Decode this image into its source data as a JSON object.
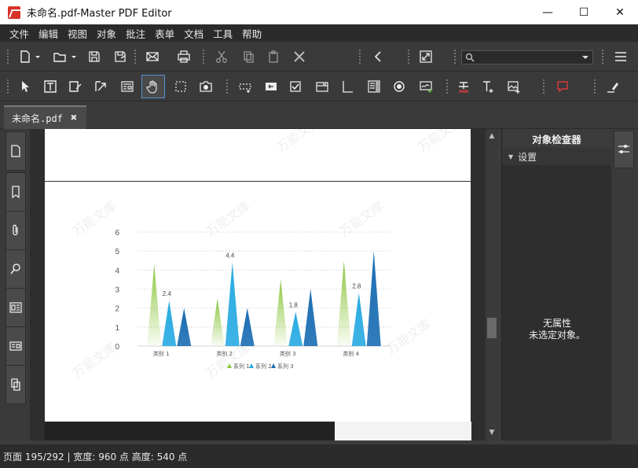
{
  "window": {
    "title": "未命名.pdf-Master PDF Editor",
    "minimize": "—",
    "maximize": "☐",
    "close": "✕"
  },
  "menu": [
    "文件",
    "编辑",
    "视图",
    "对象",
    "批注",
    "表单",
    "文档",
    "工具",
    "帮助"
  ],
  "tab": {
    "label": "未命名.pdf",
    "close": "✖"
  },
  "inspector": {
    "title": "对象检查器",
    "section": "设置",
    "empty_line1": "无属性",
    "empty_line2": "未选定对象。"
  },
  "status": "页面 195/292 | 宽度: 960 点 高度: 540 点",
  "colors": {
    "accent": "#5a8fd0",
    "series1": "#8dc63f",
    "series2": "#29abe2",
    "series3": "#1b6eb3"
  },
  "chart_data": {
    "type": "bar",
    "categories": [
      "类别 1",
      "类别 2",
      "类别 3",
      "类别 4"
    ],
    "series": [
      {
        "name": "系列 1",
        "values": [
          4.3,
          2.5,
          3.5,
          4.5
        ]
      },
      {
        "name": "系列 2",
        "values": [
          2.4,
          4.4,
          1.8,
          2.8
        ]
      },
      {
        "name": "系列 3",
        "values": [
          2.0,
          2.0,
          3.0,
          5.0
        ]
      }
    ],
    "data_labels": [
      "2.4",
      "4.4",
      "1.8",
      "2.8"
    ],
    "yticks": [
      "0",
      "1",
      "2",
      "3",
      "4",
      "5",
      "6"
    ],
    "ylim": [
      0,
      6
    ],
    "grid": true,
    "legend": "bottom"
  }
}
